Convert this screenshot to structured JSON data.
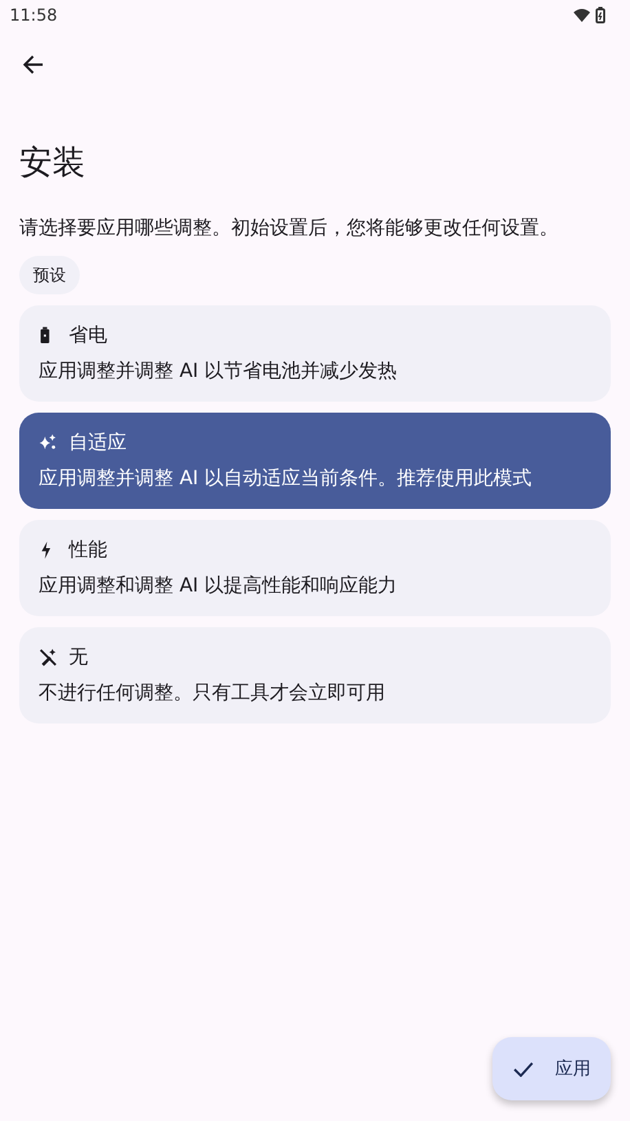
{
  "status_bar": {
    "time": "11:58"
  },
  "title": "安装",
  "description": "请选择要应用哪些调整。初始设置后，您将能够更改任何设置。",
  "chip": "预设",
  "options": [
    {
      "kind": "battery",
      "title": "省电",
      "subtitle": "应用调整并调整 AI 以节省电池并减少发热",
      "selected": false
    },
    {
      "kind": "sparkle",
      "title": "自适应",
      "subtitle": "应用调整并调整 AI 以自动适应当前条件。推荐使用此模式",
      "selected": true
    },
    {
      "kind": "bolt",
      "title": "性能",
      "subtitle": "应用调整和调整 AI 以提高性能和响应能力",
      "selected": false
    },
    {
      "kind": "none",
      "title": "无",
      "subtitle": "不进行任何调整。只有工具才会立即可用",
      "selected": false
    }
  ],
  "fab": {
    "label": "应用"
  }
}
